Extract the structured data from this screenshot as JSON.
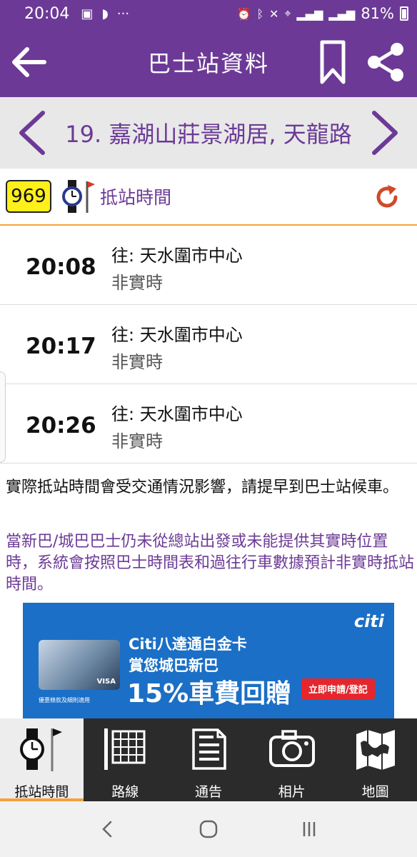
{
  "status_bar": {
    "time": "20:04",
    "left_icons": [
      "sim-card-icon",
      "cast-icon",
      "more-dots-icon"
    ],
    "right_icons": [
      "alarm-icon",
      "bluetooth-icon",
      "mute-icon",
      "location-icon",
      "signal-lte1-icon",
      "signal-lte2-icon"
    ],
    "dots": "···",
    "battery_text": "81%",
    "battery_level": 0.81
  },
  "app_bar": {
    "title": "巴士站資料"
  },
  "stop_bar": {
    "stop_name": "19. 嘉湖山莊景湖居, 天龍路"
  },
  "route": {
    "number": "969",
    "eta_label": "抵站時間"
  },
  "eta_items": [
    {
      "time": "20:08",
      "destination": "往: 天水圍市中心",
      "status": "非實時"
    },
    {
      "time": "20:17",
      "destination": "往: 天水圍市中心",
      "status": "非實時"
    },
    {
      "time": "20:26",
      "destination": "往: 天水圍市中心",
      "status": "非實時"
    }
  ],
  "notes": {
    "note1": "實際抵站時間會受交通情況影響，請提早到巴士站候車。",
    "note2": "當新巴/城巴巴士仍未從總站出發或未能提供其實時位置時，系統會按照巴士時間表和過往行車數據預計非實時抵站時間。"
  },
  "ad": {
    "brand": "citi",
    "line1": "Citi八達通白金卡",
    "line2": "賞您城巴新巴",
    "line3": "15%車費回贈",
    "cta": "立即申請/登記",
    "card_brand": "VISA",
    "fine_print": "優惠條款及細則適用"
  },
  "bottom_nav": [
    {
      "label": "抵站時間",
      "icon": "eta-clock-icon",
      "active": true
    },
    {
      "label": "路線",
      "icon": "route-table-icon",
      "active": false
    },
    {
      "label": "通告",
      "icon": "notice-document-icon",
      "active": false
    },
    {
      "label": "相片",
      "icon": "camera-icon",
      "active": false
    },
    {
      "label": "地圖",
      "icon": "map-icon",
      "active": false
    }
  ],
  "colors": {
    "primary": "#6c3a96",
    "accent": "#f2a23a",
    "refresh": "#d04a2a",
    "route_badge": "#ffef1a",
    "ad_background": "#1b6fc6"
  }
}
